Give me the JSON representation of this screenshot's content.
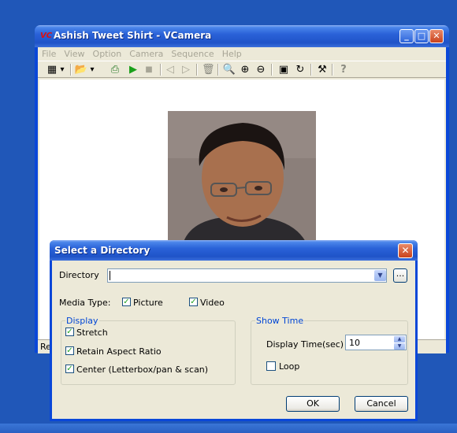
{
  "window": {
    "title": "Ashish Tweet Shirt - VCamera",
    "menu": [
      "File",
      "View",
      "Option",
      "Camera",
      "Sequence",
      "Help"
    ],
    "status": "Rea",
    "controls": {
      "minimize": "_",
      "maximize": "□",
      "close": "✕"
    }
  },
  "toolbar": {
    "items": [
      {
        "icon": "film-icon",
        "glyph": "▦"
      },
      {
        "icon": "dropdown-arrow-icon",
        "glyph": "▾"
      },
      {
        "icon": "open-folder-icon",
        "glyph": "📂"
      },
      {
        "icon": "dropdown-arrow-icon",
        "glyph": "▾"
      },
      {
        "icon": "export-icon",
        "glyph": "⎙"
      },
      {
        "icon": "play-icon",
        "glyph": "▶"
      },
      {
        "icon": "stop-icon",
        "glyph": "■"
      },
      {
        "icon": "previous-icon",
        "glyph": "◁"
      },
      {
        "icon": "next-icon",
        "glyph": "▷"
      },
      {
        "icon": "delete-icon",
        "glyph": "🗑"
      },
      {
        "icon": "zoom-fit-icon",
        "glyph": "🔍"
      },
      {
        "icon": "zoom-in-icon",
        "glyph": "⊕"
      },
      {
        "icon": "zoom-out-icon",
        "glyph": "⊖"
      },
      {
        "icon": "fullscreen-icon",
        "glyph": "▣"
      },
      {
        "icon": "rotate-icon",
        "glyph": "↻"
      },
      {
        "icon": "settings-tools-icon",
        "glyph": "⚒"
      },
      {
        "icon": "help-icon",
        "glyph": "?"
      }
    ]
  },
  "dialog": {
    "title": "Select a Directory",
    "close": "✕",
    "directory_label": "Directory",
    "directory_value": "",
    "browse_label": "...",
    "media_type_label": "Media Type:",
    "picture_label": "Picture",
    "picture_checked": true,
    "video_label": "Video",
    "video_checked": true,
    "display_group": "Display",
    "stretch_label": "Stretch",
    "stretch_checked": true,
    "retain_label": "Retain Aspect Ratio",
    "retain_checked": true,
    "center_label": "Center (Letterbox/pan & scan)",
    "center_checked": true,
    "show_time_group": "Show Time",
    "display_time_label": "Display Time(sec)",
    "display_time_value": "10",
    "loop_label": "Loop",
    "loop_checked": false,
    "ok_label": "OK",
    "cancel_label": "Cancel"
  }
}
